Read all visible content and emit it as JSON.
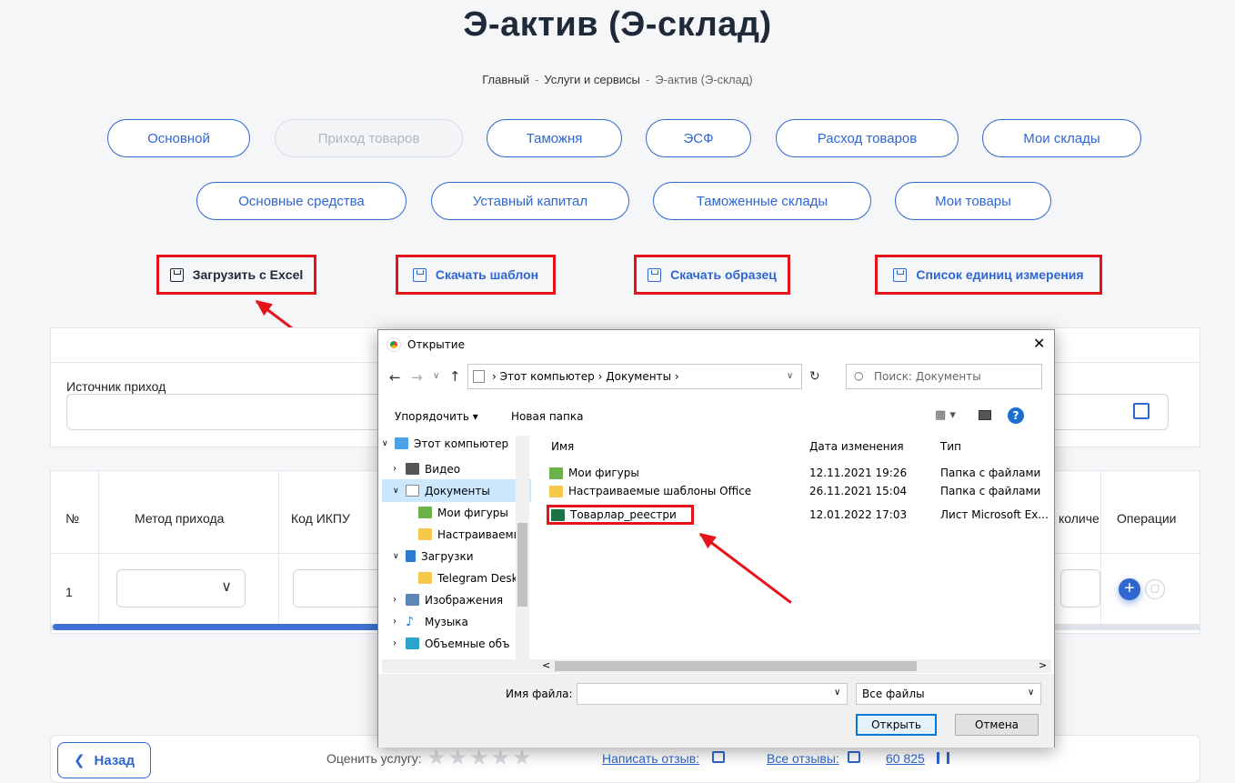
{
  "page": {
    "title": "Э-актив (Э-склад)"
  },
  "breadcrumb": {
    "home": "Главный",
    "sep": "-",
    "services": "Услуги и сервисы",
    "current": "Э-актив (Э-склад)"
  },
  "tabs": {
    "row1": [
      "Основной",
      "Приход товаров",
      "Таможня",
      "ЭСФ",
      "Расход товаров",
      "Мои склады"
    ],
    "row2": [
      "Основные средства",
      "Уставный капитал",
      "Таможенные склады",
      "Мои товары"
    ]
  },
  "actions": {
    "upload": "Загрузить с Excel",
    "template": "Скачать шаблон",
    "sample": "Скачать образец",
    "units": "Список единиц измерения"
  },
  "form": {
    "source_label": "Источник приход"
  },
  "table": {
    "headers": {
      "num": "№",
      "method": "Метод прихода",
      "ikpu": "Код ИКПУ",
      "qty": "количе",
      "ops": "Операции"
    },
    "row_num": "1"
  },
  "footer": {
    "back": "Назад",
    "rate_label": "Оценить услугу:",
    "write_review": "Написать отзыв:",
    "all_reviews": "Все отзывы:",
    "count": "60 825"
  },
  "dialog": {
    "title": "Открытие",
    "path": {
      "pc": "Этот компьютер",
      "docs": "Документы"
    },
    "search_placeholder": "Поиск: Документы",
    "toolbar": {
      "organize": "Упорядочить ▾",
      "new_folder": "Новая папка"
    },
    "tree": [
      "Этот компьютер",
      "Видео",
      "Документы",
      "Мои фигуры",
      "Настраиваемы",
      "Загрузки",
      "Telegram Deskt",
      "Изображения",
      "Музыка",
      "Объемные объ"
    ],
    "columns": {
      "name": "Имя",
      "date": "Дата изменения",
      "type": "Тип"
    },
    "files": [
      {
        "name": "Мои фигуры",
        "date": "12.11.2021 19:26",
        "type": "Папка с файлами"
      },
      {
        "name": "Настраиваемые шаблоны Office",
        "date": "26.11.2021 15:04",
        "type": "Папка с файлами"
      },
      {
        "name": "Товарлар_реестри",
        "date": "12.01.2022 17:03",
        "type": "Лист Microsoft Ex..."
      }
    ],
    "filename_label": "Имя файла:",
    "filetype": "Все файлы",
    "open": "Открыть",
    "cancel": "Отмена"
  },
  "colors": {
    "accent": "#2f66d0",
    "highlight": "#e5141b"
  }
}
